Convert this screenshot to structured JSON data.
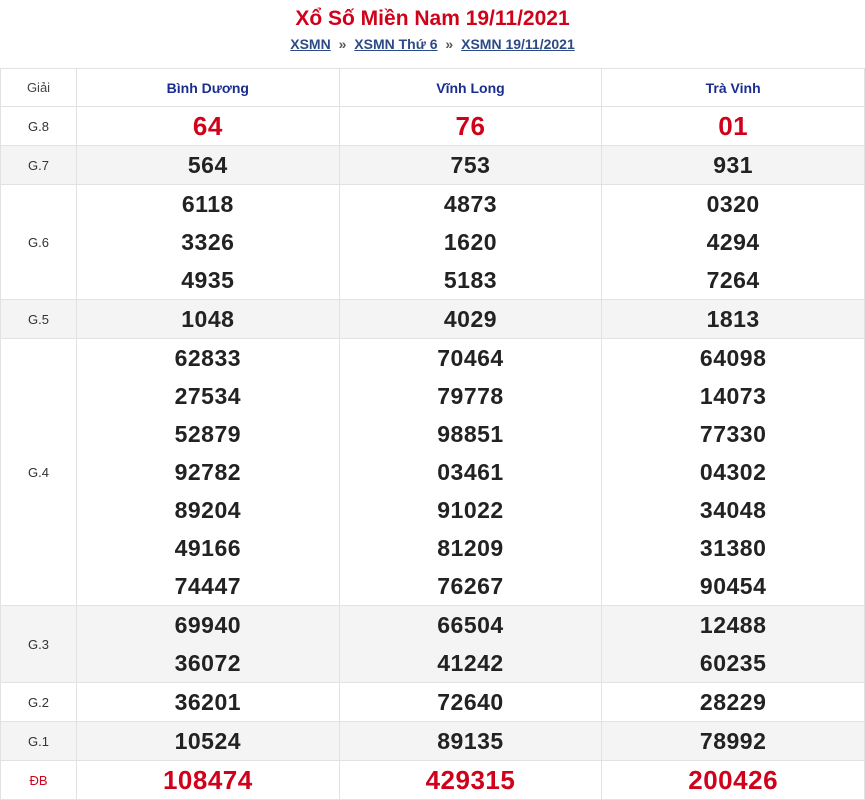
{
  "title": "Xổ Số Miền Nam 19/11/2021",
  "breadcrumb": [
    {
      "label": "XSMN"
    },
    {
      "label": "XSMN Thứ 6"
    },
    {
      "label": "XSMN 19/11/2021"
    }
  ],
  "breadcrumb_sep": "»",
  "table": {
    "header_label": "Giải",
    "provinces": [
      "Bình Dương",
      "Vĩnh Long",
      "Trà Vinh"
    ],
    "rows": [
      {
        "label": "G.8",
        "alt": false,
        "red": true,
        "values": [
          [
            "64"
          ],
          [
            "76"
          ],
          [
            "01"
          ]
        ]
      },
      {
        "label": "G.7",
        "alt": true,
        "red": false,
        "values": [
          [
            "564"
          ],
          [
            "753"
          ],
          [
            "931"
          ]
        ]
      },
      {
        "label": "G.6",
        "alt": false,
        "red": false,
        "values": [
          [
            "6118",
            "3326",
            "4935"
          ],
          [
            "4873",
            "1620",
            "5183"
          ],
          [
            "0320",
            "4294",
            "7264"
          ]
        ]
      },
      {
        "label": "G.5",
        "alt": true,
        "red": false,
        "values": [
          [
            "1048"
          ],
          [
            "4029"
          ],
          [
            "1813"
          ]
        ]
      },
      {
        "label": "G.4",
        "alt": false,
        "red": false,
        "values": [
          [
            "62833",
            "27534",
            "52879",
            "92782",
            "89204",
            "49166",
            "74447"
          ],
          [
            "70464",
            "79778",
            "98851",
            "03461",
            "91022",
            "81209",
            "76267"
          ],
          [
            "64098",
            "14073",
            "77330",
            "04302",
            "34048",
            "31380",
            "90454"
          ]
        ]
      },
      {
        "label": "G.3",
        "alt": true,
        "red": false,
        "values": [
          [
            "69940",
            "36072"
          ],
          [
            "66504",
            "41242"
          ],
          [
            "12488",
            "60235"
          ]
        ]
      },
      {
        "label": "G.2",
        "alt": false,
        "red": false,
        "values": [
          [
            "36201"
          ],
          [
            "72640"
          ],
          [
            "28229"
          ]
        ]
      },
      {
        "label": "G.1",
        "alt": true,
        "red": false,
        "values": [
          [
            "10524"
          ],
          [
            "89135"
          ],
          [
            "78992"
          ]
        ]
      },
      {
        "label": "ĐB",
        "alt": false,
        "red": true,
        "values": [
          [
            "108474"
          ],
          [
            "429315"
          ],
          [
            "200426"
          ]
        ]
      }
    ]
  }
}
